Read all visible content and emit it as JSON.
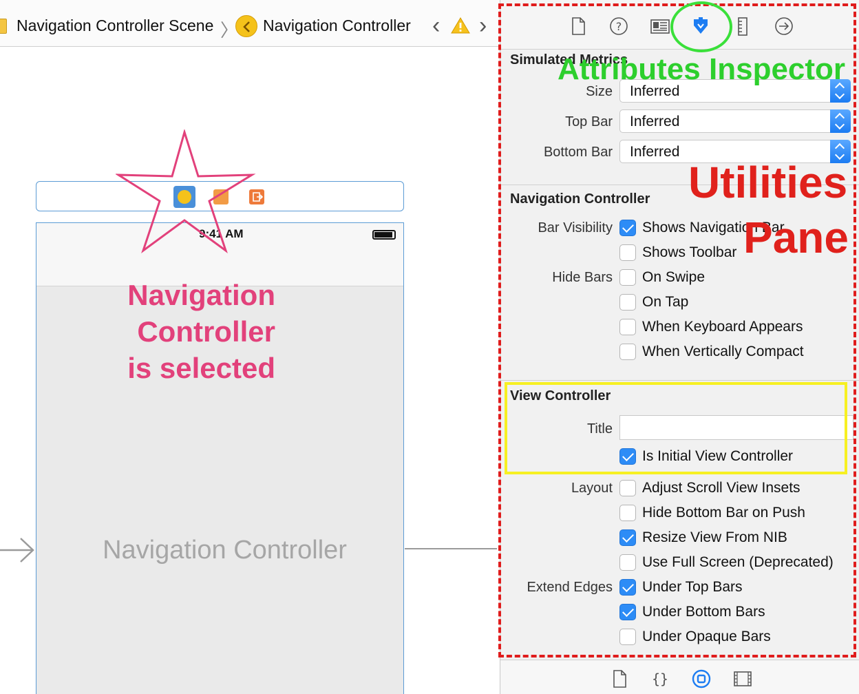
{
  "breadcrumb": {
    "scene_label": "Navigation Controller Scene",
    "controller_label": "Navigation Controller",
    "sep": "〉",
    "back_glyph": "‹",
    "forward_glyph": "›",
    "icons": [
      "storyboard-scene-icon",
      "navigation-controller-icon",
      "warning-icon"
    ]
  },
  "canvas": {
    "status_time": "9:41 AM",
    "scene_title": "Navigation Controller",
    "dock_icons": [
      "navigation-controller-icon",
      "first-responder-icon",
      "exit-icon"
    ]
  },
  "inspector": {
    "tabs": [
      "file-icon",
      "quick-help-icon",
      "identity-icon",
      "attributes-icon",
      "size-icon",
      "connections-icon"
    ],
    "active_tab": "attributes-icon",
    "simulated_metrics": {
      "title": "Simulated Metrics",
      "size_label": "Size",
      "size_value": "Inferred",
      "top_bar_label": "Top Bar",
      "top_bar_value": "Inferred",
      "bottom_bar_label": "Bottom Bar",
      "bottom_bar_value": "Inferred"
    },
    "navigation_controller": {
      "title": "Navigation Controller",
      "bar_visibility_label": "Bar Visibility",
      "shows_navigation_bar": "Shows Navigation Bar",
      "shows_navigation_bar_checked": true,
      "shows_toolbar": "Shows Toolbar",
      "shows_toolbar_checked": false,
      "hide_bars_label": "Hide Bars",
      "on_swipe": "On Swipe",
      "on_tap": "On Tap",
      "when_keyboard_appears": "When Keyboard Appears",
      "when_vertically_compact": "When Vertically Compact"
    },
    "view_controller": {
      "title": "View Controller",
      "title_label": "Title",
      "title_value": "",
      "is_initial": "Is Initial View Controller",
      "is_initial_checked": true,
      "layout_label": "Layout",
      "adjust_scroll_view_insets": "Adjust Scroll View Insets",
      "hide_bottom_bar_on_push": "Hide Bottom Bar on Push",
      "resize_view_from_nib": "Resize View From NIB",
      "resize_view_from_nib_checked": true,
      "use_full_screen": "Use Full Screen (Deprecated)",
      "extend_edges_label": "Extend Edges",
      "under_top_bars": "Under Top Bars",
      "under_top_bars_checked": true,
      "under_bottom_bars": "Under Bottom Bars",
      "under_bottom_bars_checked": true,
      "under_opaque_bars": "Under Opaque Bars"
    },
    "library_tabs": [
      "file-template-icon",
      "code-snippet-icon",
      "object-library-icon",
      "media-library-icon"
    ],
    "active_library_tab": "object-library-icon"
  },
  "annotations": {
    "attributes_inspector": "Attributes Inspector",
    "utilities": "Utilities",
    "pane": "Pane",
    "selected_line1": "Navigation",
    "selected_line2": "Controller",
    "selected_line3": "is selected",
    "colors": {
      "red": "#e0211c",
      "green": "#2dcf2d",
      "yellow": "#f7f022",
      "pink": "#e2417b"
    }
  }
}
